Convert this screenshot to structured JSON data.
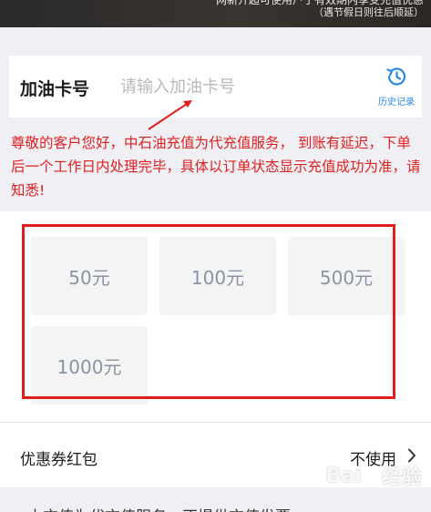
{
  "banner": {
    "text_line1": "网新开超可使用户于有效期内享受充值优惠",
    "text_line2": "（遇节假日则往后顺延）"
  },
  "card": {
    "label": "加油卡号",
    "placeholder": "请输入加油卡号",
    "history_label": "历史记录",
    "history_icon": "history-clock-icon"
  },
  "notice": {
    "text": "尊敬的客户您好，中石油充值为代充值服务， 到账有延迟，下单后一个工作日内处理完毕，具体以订单状态显示充值成功为准，请知悉!"
  },
  "amounts": {
    "options": [
      "50元",
      "100元",
      "500元",
      "1000元"
    ]
  },
  "coupon": {
    "label": "优惠券红包",
    "value": "不使用"
  },
  "footer": {
    "text": "本充值为代充值服务，不提供充值发票"
  },
  "colors": {
    "notice": "#e02020",
    "highlight_box": "#e01e1e",
    "history_accent": "#2b8ae8",
    "amount_text": "#8a95a3"
  }
}
